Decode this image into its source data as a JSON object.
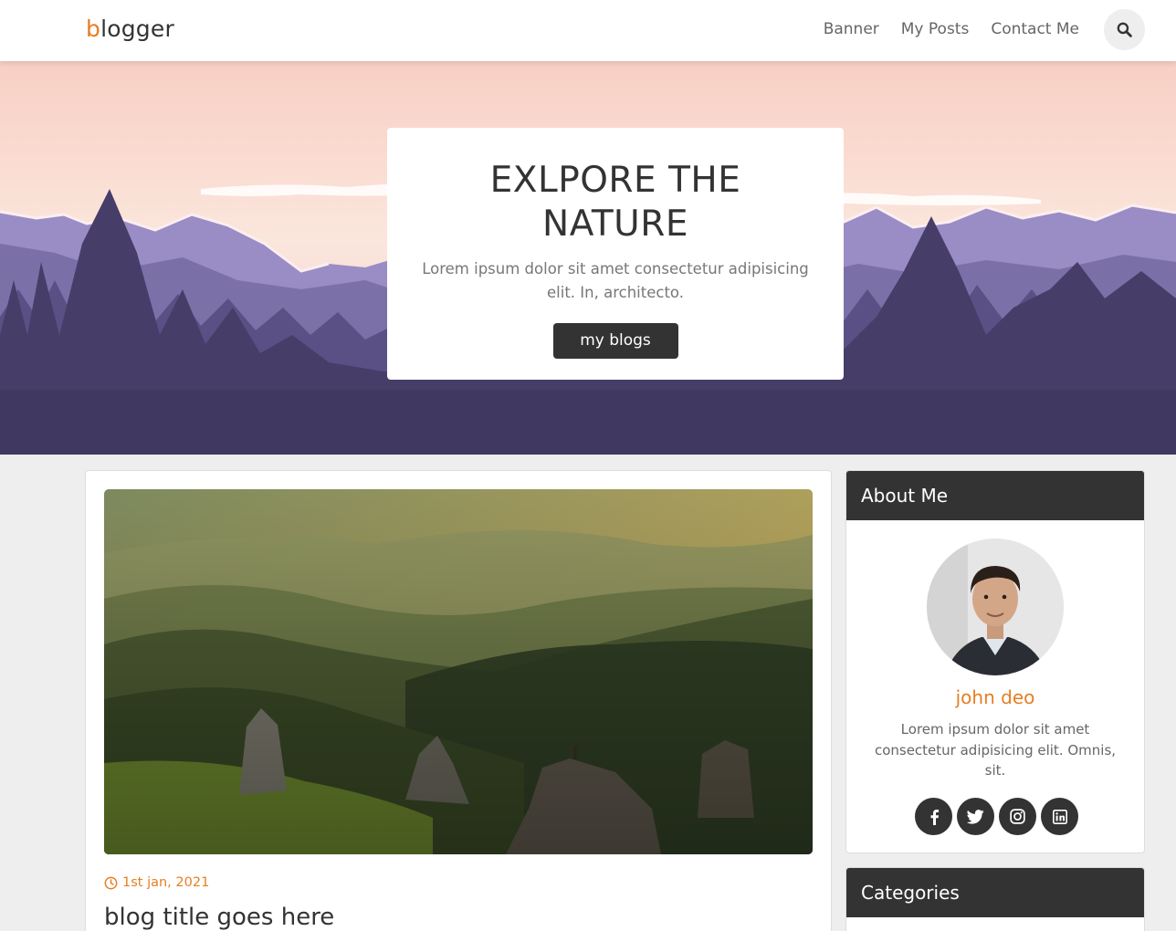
{
  "header": {
    "logo_first": "b",
    "logo_rest": "logger",
    "nav": [
      {
        "label": "Banner"
      },
      {
        "label": "My Posts"
      },
      {
        "label": "Contact Me"
      }
    ],
    "search_icon": "search-icon"
  },
  "hero": {
    "title": "EXLPORE THE NATURE",
    "text": "Lorem ipsum dolor sit amet consectetur adipisicing elit. In, architecto.",
    "button": "my blogs"
  },
  "post": {
    "date": "1st jan, 2021",
    "title": "blog title goes here"
  },
  "about": {
    "heading": "About Me",
    "name": "john deo",
    "text": "Lorem ipsum dolor sit amet consectetur adipisicing elit. Omnis, sit.",
    "socials": [
      "facebook-icon",
      "twitter-icon",
      "instagram-icon",
      "linkedin-icon"
    ]
  },
  "categories": {
    "heading": "Categories"
  },
  "colors": {
    "accent": "#e67e22",
    "dark": "#333333",
    "page_bg": "#eeeeee"
  }
}
